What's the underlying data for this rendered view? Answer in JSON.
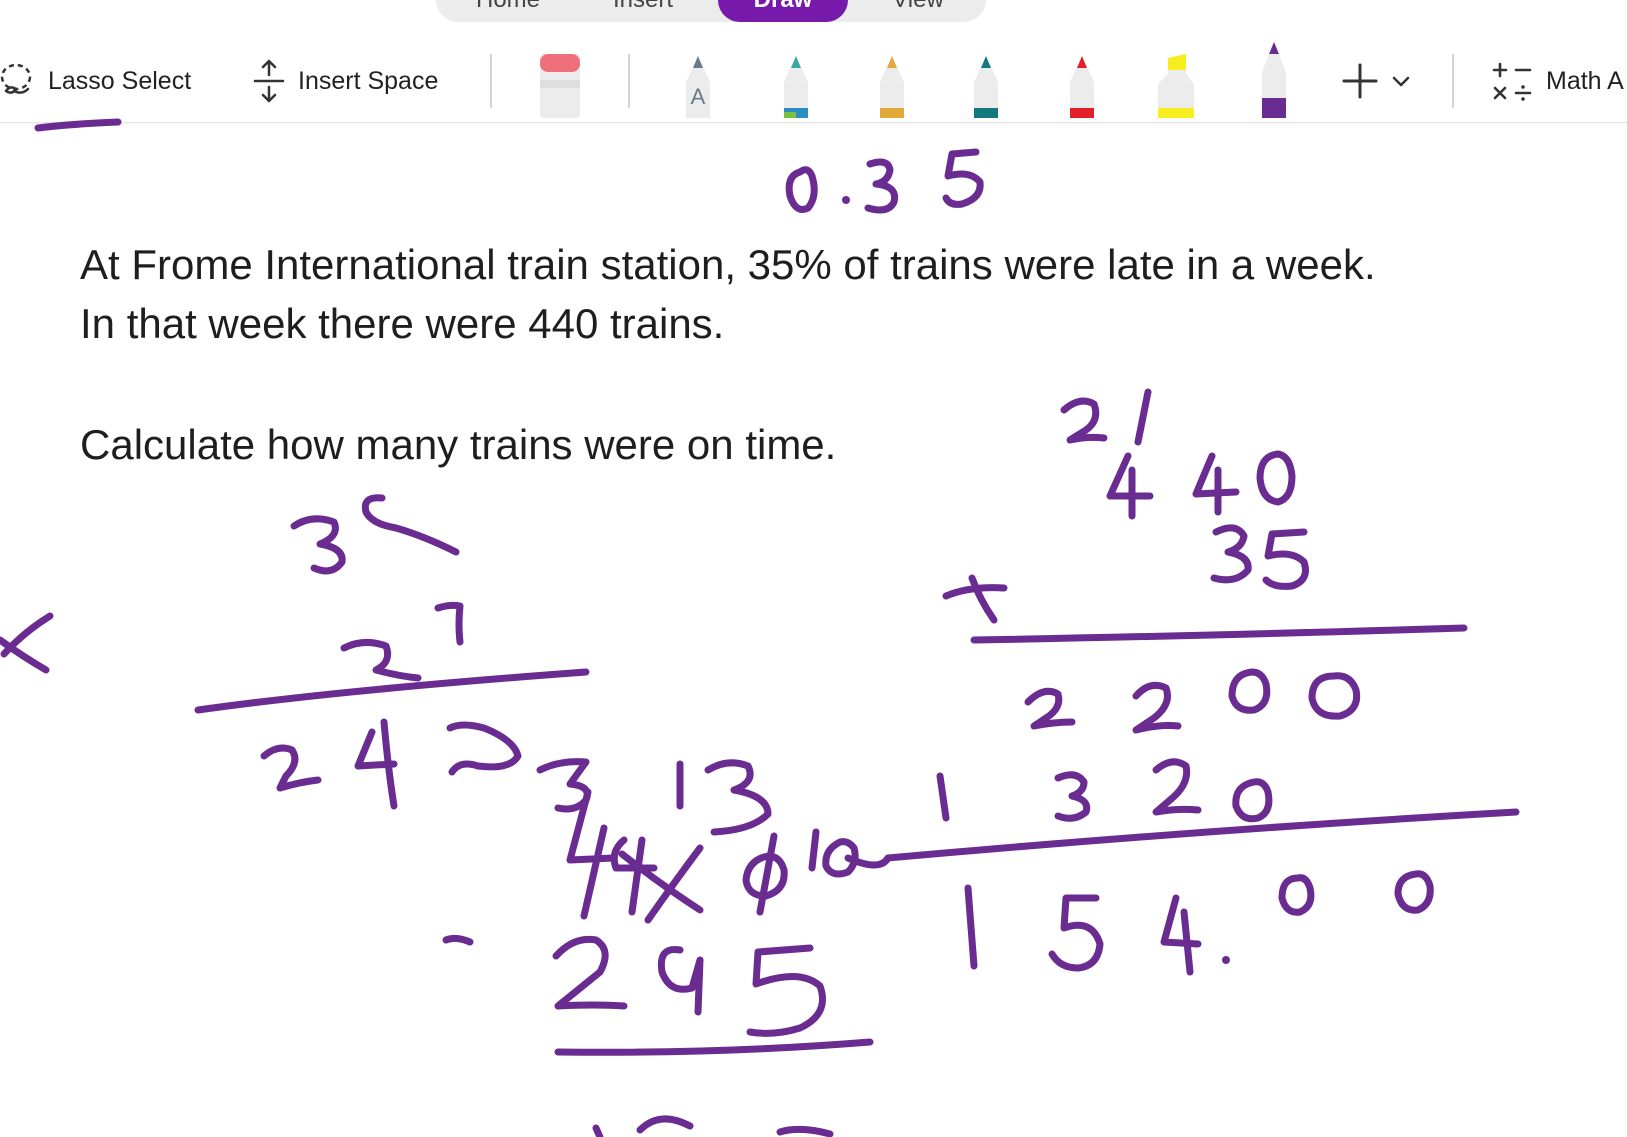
{
  "tabs": [
    {
      "label": "Home"
    },
    {
      "label": "Insert"
    },
    {
      "label": "Draw"
    },
    {
      "label": "View"
    }
  ],
  "toolbar": {
    "lasso_label": "Lasso Select",
    "insert_space_label": "Insert Space",
    "math_label": "Math A",
    "pens": [
      {
        "name": "eraser",
        "color": "#f06f7c"
      },
      {
        "name": "text-pen",
        "color": "#6b7a86",
        "letter": "A"
      },
      {
        "name": "galaxy-pen",
        "color": "#3aa99f"
      },
      {
        "name": "gold-pen",
        "color": "#e2a83a"
      },
      {
        "name": "teal-pen",
        "color": "#127a7e"
      },
      {
        "name": "red-pen",
        "color": "#e3202a"
      },
      {
        "name": "yellow-highlighter",
        "color": "#f7ee1f"
      },
      {
        "name": "purple-pen",
        "color": "#6a2c91",
        "selected": true
      }
    ]
  },
  "question": {
    "number": ".",
    "line1": "At Frome International train station, 35% of trains were late in a week.",
    "line2": "In that week there were 440 trains.",
    "line3": "Calculate how many trains were on time."
  },
  "ink_color": "#6a2c91"
}
